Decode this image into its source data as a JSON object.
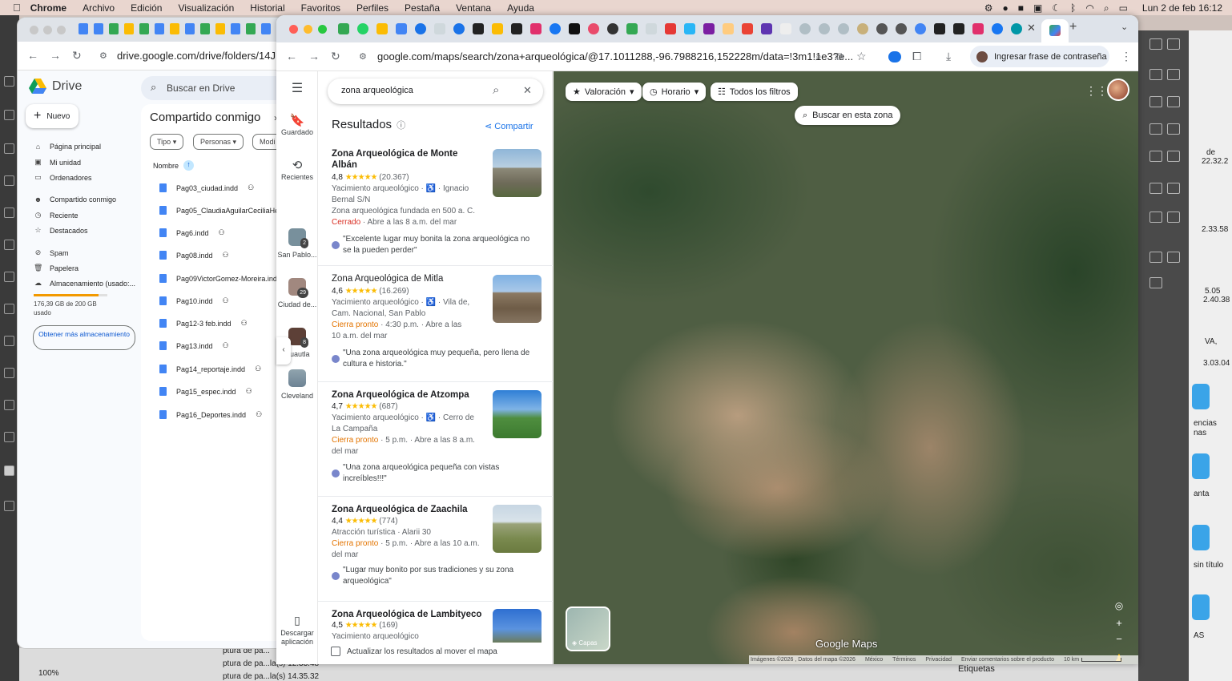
{
  "menubar": {
    "app": "Chrome",
    "items": [
      "Archivo",
      "Edición",
      "Visualización",
      "Historial",
      "Favoritos",
      "Perfiles",
      "Pestaña",
      "Ventana",
      "Ayuda"
    ],
    "datetime": "Lun 2 de feb  16:12"
  },
  "drive": {
    "url": "drive.google.com/drive/folders/14JUB",
    "logo_text": "Drive",
    "search_placeholder": "Buscar en Drive",
    "new_button": "Nuevo",
    "nav": [
      "Página principal",
      "Mi unidad",
      "Ordenadores",
      "Compartido conmigo",
      "Reciente",
      "Destacados",
      "Spam",
      "Papelera",
      "Almacenamiento (usado:..."
    ],
    "storage_used_text": "176,39 GB de 200 GB usado",
    "storage_fraction": 0.88,
    "more_storage": "Obtener más almacenamiento",
    "page_title": "Compartido conmigo",
    "chips": [
      "Tipo",
      "Personas",
      "Modi"
    ],
    "sort_column": "Nombre",
    "files": [
      "Pag03_ciudad.indd",
      "Pag05_ClaudiaAguilarCeciliaHe",
      "Pag6.indd",
      "Pag08.indd",
      "Pag09VictorGomez-Moreira.ind",
      "Pag10.indd",
      "Pag12-3 feb.indd",
      "Pag13.indd",
      "Pag14_reportaje.indd",
      "Pag15_espec.indd",
      "Pag16_Deportes.indd"
    ]
  },
  "chrome": {
    "url": "google.com/maps/search/zona+arqueológica/@17.1011288,-96.7988216,152228m/data=!3m1!1e3?e...",
    "passkey": "Ingresar frase de contraseña"
  },
  "rail": {
    "saved": "Guardado",
    "recent": "Recientes",
    "places": [
      {
        "name": "San Pablo...",
        "badge": "2"
      },
      {
        "name": "Ciudad de...",
        "badge": "29"
      },
      {
        "name": "Cuautla",
        "badge": "8"
      },
      {
        "name": "Cleveland",
        "badge": ""
      }
    ],
    "download": "Descargar aplicación"
  },
  "search": {
    "query": "zona arqueológica"
  },
  "results": {
    "heading": "Resultados",
    "share": "Compartir",
    "items": [
      {
        "name": "Zona Arqueológica de Monte Albán",
        "rating": "4,8",
        "stars": "★★★★★",
        "reviews": "(20.367)",
        "type": "Yacimiento arqueológico · ♿ · Ignacio",
        "address2": "Bernal S/N",
        "extra": "Zona arqueológica fundada en 500 a. C.",
        "status": "Cerrado",
        "status_rest": " · Abre a las 8 a.m. del mar",
        "status_rest2": "",
        "review": "\"Excelente lugar muy bonita la zona arqueológica no se la pueden perder\""
      },
      {
        "name": "Zona Arqueológica de Mitla",
        "rating": "4,6",
        "stars": "★★★★★",
        "reviews": "(16.269)",
        "type": "Yacimiento arqueológico · ♿ · Vila de,",
        "address2": "Cam. Nacional, San Pablo",
        "extra": "",
        "status": "Cierra pronto",
        "status_rest": " · 4:30 p.m. · Abre a las",
        "status_rest2": "10 a.m. del mar",
        "review": "\"Una zona arqueológica muy pequeña, pero llena de cultura e historia.\""
      },
      {
        "name": "Zona Arqueológica de Atzompa",
        "rating": "4,7",
        "stars": "★★★★★",
        "reviews": "(687)",
        "type": "Yacimiento arqueológico · ♿ · Cerro de",
        "address2": "La Campaña",
        "extra": "",
        "status": "Cierra pronto",
        "status_rest": " · 5 p.m. · Abre a las 8 a.m.",
        "status_rest2": "del mar",
        "review": "\"Una zona arqueológica pequeña con vistas increíbles!!!\""
      },
      {
        "name": "Zona Arqueológica de Zaachila",
        "rating": "4,4",
        "stars": "★★★★★",
        "reviews": "(774)",
        "type": "Atracción turística · Alarii 30",
        "address2": "",
        "extra": "",
        "status": "Cierra pronto",
        "status_rest": " · 5 p.m. · Abre a las 10 a.m.",
        "status_rest2": "del mar",
        "review": "\"Lugar muy bonito por sus tradiciones y su zona arqueológica\""
      },
      {
        "name": "Zona Arqueológica de Lambityeco",
        "rating": "4,5",
        "stars": "★★★★★",
        "reviews": "(169)",
        "type": "Yacimiento arqueológico",
        "address2": "",
        "extra": "",
        "status": "",
        "status_rest": "",
        "status_rest2": "",
        "review": ""
      }
    ],
    "update_checkbox": "Actualizar los resultados al mover el mapa"
  },
  "map": {
    "filters": [
      "Valoración",
      "Horario",
      "Todos los filtros"
    ],
    "search_area": "Buscar en esta zona",
    "layers": "Capas",
    "logo": "Google Maps",
    "attribution": [
      "Imágenes ©2026 , Datos del mapa ©2026",
      "México",
      "Términos",
      "Privacidad",
      "Enviar comentarios sobre el producto",
      "10 km"
    ]
  },
  "background_app": {
    "texts": [
      "de",
      "22.32.2",
      "2.33.58",
      "5.05",
      "2.40.38",
      "VA,",
      "3.03.04",
      "encias",
      "nas",
      "anta",
      "sin título",
      "AS",
      "Etiquetas",
      "ptura de pa...",
      "ptura de pa...la(s) 12.33.48",
      "ptura de pa...la(s) 14.35.32",
      "100%"
    ]
  }
}
